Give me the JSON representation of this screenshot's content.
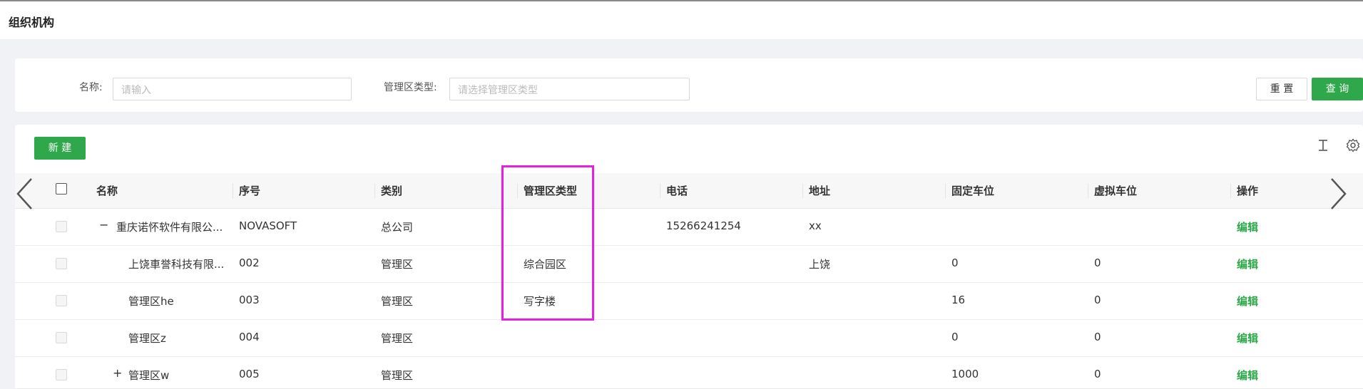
{
  "header": {
    "title": "组织机构"
  },
  "search": {
    "name_label": "名称:",
    "name_placeholder": "请输入",
    "type_label": "管理区类型:",
    "type_placeholder": "请选择管理区类型",
    "reset_label": "重 置",
    "query_label": "查 询"
  },
  "toolbar": {
    "new_label": "新 建",
    "icons": [
      "column-height-icon",
      "gear-icon"
    ]
  },
  "table": {
    "columns": [
      "名称",
      "序号",
      "类别",
      "管理区类型",
      "电话",
      "地址",
      "固定车位",
      "虚拟车位",
      "操作"
    ],
    "rows": [
      {
        "expander": "−",
        "name": "重庆诺怀软件有限公...",
        "seq": "NOVASOFT",
        "category": "总公司",
        "zone_type": "",
        "phone": "15266241254",
        "address": "xx",
        "fixed": "",
        "virtual": "",
        "action": "编辑"
      },
      {
        "expander": "",
        "name": "上饶車誉科技有限...",
        "seq": "002",
        "category": "管理区",
        "zone_type": "综合园区",
        "phone": "",
        "address": "上饶",
        "fixed": "0",
        "virtual": "0",
        "action": "编辑"
      },
      {
        "expander": "",
        "name": "管理区he",
        "seq": "003",
        "category": "管理区",
        "zone_type": "写字楼",
        "phone": "",
        "address": "",
        "fixed": "16",
        "virtual": "0",
        "action": "编辑"
      },
      {
        "expander": "",
        "name": "管理区z",
        "seq": "004",
        "category": "管理区",
        "zone_type": "",
        "phone": "",
        "address": "",
        "fixed": "0",
        "virtual": "0",
        "action": "编辑"
      },
      {
        "expander": "+",
        "name": "管理区w",
        "seq": "005",
        "category": "管理区",
        "zone_type": "",
        "phone": "",
        "address": "",
        "fixed": "1000",
        "virtual": "0",
        "action": "编辑"
      }
    ]
  },
  "colors": {
    "accent": "#2ea84a",
    "highlight": "#e81ee0"
  }
}
